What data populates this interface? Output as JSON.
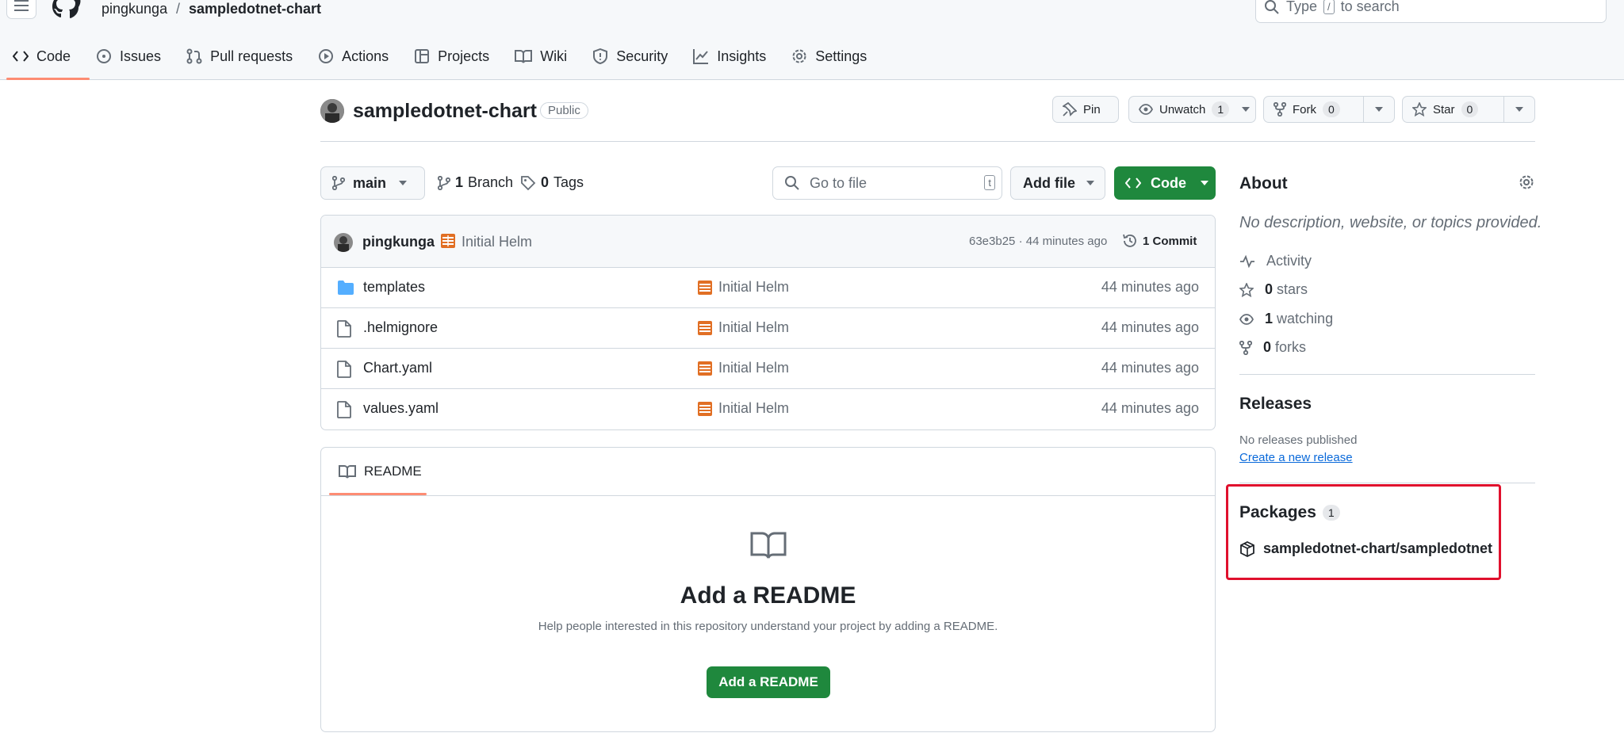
{
  "header": {
    "owner": "pingkunga",
    "separator": "/",
    "repo": "sampledotnet-chart",
    "search_type": "Type",
    "search_key": "/",
    "search_rest": "to search"
  },
  "tabs": [
    {
      "label": "Code"
    },
    {
      "label": "Issues"
    },
    {
      "label": "Pull requests"
    },
    {
      "label": "Actions"
    },
    {
      "label": "Projects"
    },
    {
      "label": "Wiki"
    },
    {
      "label": "Security"
    },
    {
      "label": "Insights"
    },
    {
      "label": "Settings"
    }
  ],
  "repo": {
    "name": "sampledotnet-chart",
    "visibility": "Public",
    "pin_label": "Pin",
    "unwatch_label": "Unwatch",
    "unwatch_count": "1",
    "fork_label": "Fork",
    "fork_count": "0",
    "star_label": "Star",
    "star_count": "0"
  },
  "filenav": {
    "branch": "main",
    "branches_count": "1",
    "branches_label": "Branch",
    "tags_count": "0",
    "tags_label": "Tags",
    "goto_placeholder": "Go to file",
    "goto_key": "t",
    "add_file": "Add file",
    "code_button": "Code"
  },
  "latest_commit": {
    "author": "pingkunga",
    "message": "Initial Helm",
    "hash_time": "63e3b25 · 44 minutes ago",
    "commits_label": "1 Commit"
  },
  "files": [
    {
      "name": "templates",
      "type": "folder",
      "message": "Initial Helm",
      "age": "44 minutes ago"
    },
    {
      "name": ".helmignore",
      "type": "file",
      "message": "Initial Helm",
      "age": "44 minutes ago"
    },
    {
      "name": "Chart.yaml",
      "type": "file",
      "message": "Initial Helm",
      "age": "44 minutes ago"
    },
    {
      "name": "values.yaml",
      "type": "file",
      "message": "Initial Helm",
      "age": "44 minutes ago"
    }
  ],
  "readme": {
    "tab_label": "README",
    "title": "Add a README",
    "subtitle": "Help people interested in this repository understand your project by adding a README.",
    "button": "Add a README"
  },
  "about": {
    "title": "About",
    "description": "No description, website, or topics provided.",
    "activity": "Activity",
    "stars_count": "0",
    "stars_label": "stars",
    "watching_count": "1",
    "watching_label": "watching",
    "forks_count": "0",
    "forks_label": "forks"
  },
  "releases": {
    "title": "Releases",
    "none": "No releases published",
    "create_link": "Create a new release"
  },
  "packages": {
    "title": "Packages",
    "count": "1",
    "item": "sampledotnet-chart/sampledotnet"
  },
  "colors": {
    "green": "#1f883d",
    "accent_underline": "#fd8c73",
    "highlight": "#e0102d",
    "folder": "#54aeff",
    "commit_icon": "#e16f24"
  }
}
